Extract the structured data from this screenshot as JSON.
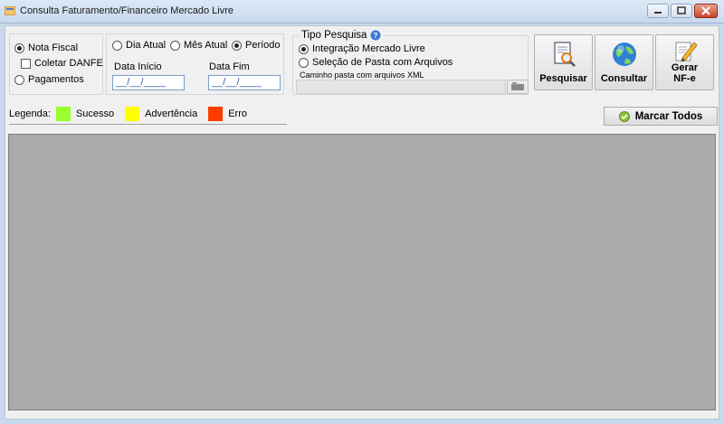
{
  "window": {
    "title": "Consulta Faturamento/Financeiro Mercado Livre"
  },
  "tipo_documento": {
    "nota_fiscal": "Nota Fiscal",
    "coletar_danfe": "Coletar DANFE",
    "pagamentos": "Pagamentos"
  },
  "periodo": {
    "dia_atual": "Dia Atual",
    "mes_atual": "Mês Atual",
    "periodo": "Período",
    "data_inicio_label": "Data Início",
    "data_fim_label": "Data Fim",
    "data_inicio_value": "__/__/____",
    "data_fim_value": "__/__/____"
  },
  "tipo_pesquisa": {
    "title": "Tipo Pesquisa",
    "integracao": "Integração Mercado Livre",
    "selecao_pasta": "Seleção de Pasta com Arquivos",
    "caminho_label": "Caminho pasta com arquivos XML"
  },
  "actions": {
    "pesquisar": "Pesquisar",
    "consultar": "Consultar",
    "gerar_nfe": "Gerar\nNF-e"
  },
  "legend": {
    "label": "Legenda:",
    "sucesso": "Sucesso",
    "advertencia": "Advertência",
    "erro": "Erro"
  },
  "marcar_todos": "Marcar Todos",
  "colors": {
    "sucesso": "#9aff2e",
    "advertencia": "#ffff00",
    "erro": "#ff3c00",
    "grid": "#ababab"
  }
}
